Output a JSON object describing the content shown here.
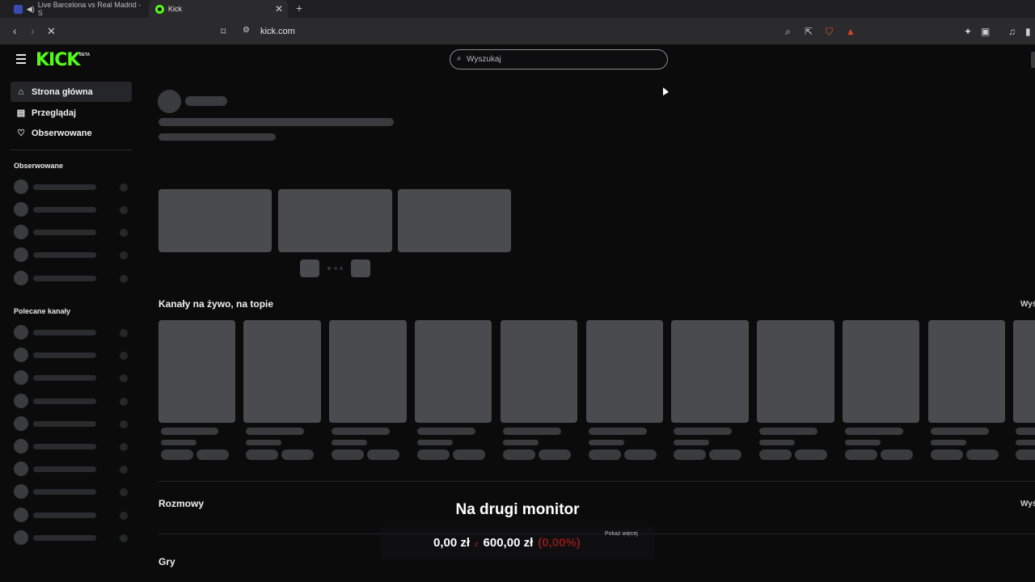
{
  "browser": {
    "tabs": [
      {
        "title": "Live Barcelona vs Real Madrid - S"
      },
      {
        "title": "Kick"
      }
    ],
    "url": "kick.com"
  },
  "site": {
    "logo": "KICK",
    "logo_badge": "BETA",
    "search_placeholder": "Wyszukaj"
  },
  "sidebar": {
    "nav": [
      {
        "label": "Strona główna",
        "icon": "home-icon"
      },
      {
        "label": "Przeglądaj",
        "icon": "browse-icon"
      },
      {
        "label": "Obserwowane",
        "icon": "heart-icon"
      }
    ],
    "followed_heading": "Obserwowane",
    "recommended_heading": "Polecane kanały"
  },
  "main": {
    "live_title": "Kanały na żywo, na topie",
    "live_more": "Wyś",
    "talks_title": "Rozmowy",
    "talks_more": "Wyś",
    "games_title": "Gry"
  },
  "overlay": {
    "title": "Na drugi monitor",
    "current": "0,00 zł",
    "sep": "z",
    "goal": "600,00 zł",
    "percent": "(0,00%)",
    "show_more": "Pokaż więcej"
  },
  "colors": {
    "brand": "#53fc18",
    "background": "#0b0b0c",
    "skeleton": "#4a4b4f"
  }
}
